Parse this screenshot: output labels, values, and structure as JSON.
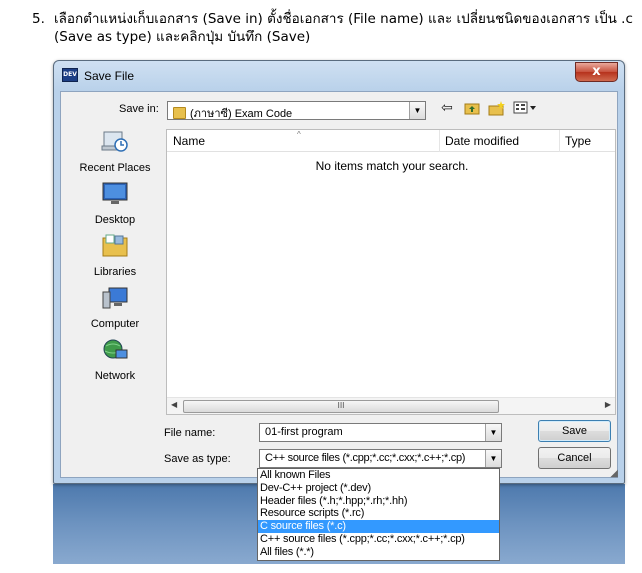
{
  "instruction": {
    "number": "5.",
    "text": "เลือกตำแหน่งเก็บเอกสาร (Save in) ตั้งชื่อเอกสาร (File name) และ เปลี่ยนชนิดของเอกสาร เป็น .c (Save as type) และคลิกปุ่ม บันทึก (Save)"
  },
  "dialog": {
    "title": "Save File",
    "app_icon": "DEV",
    "close_label": "x",
    "save_in_label": "Save in:",
    "save_in_value": "(ภาษาซี) Exam Code",
    "places": [
      {
        "label": "Recent Places",
        "icon": "recent-places-icon"
      },
      {
        "label": "Desktop",
        "icon": "desktop-icon"
      },
      {
        "label": "Libraries",
        "icon": "libraries-icon"
      },
      {
        "label": "Computer",
        "icon": "computer-icon"
      },
      {
        "label": "Network",
        "icon": "network-icon"
      }
    ],
    "columns": [
      "Name",
      "Date modified",
      "Type"
    ],
    "empty_message": "No items match your search.",
    "scroll_grip": "III",
    "file_name_label": "File name:",
    "file_name_value": "01-first program",
    "save_as_type_label": "Save as type:",
    "save_as_type_value": "C++ source files (*.cpp;*.cc;*.cxx;*.c++;*.cp)",
    "save_button": "Save",
    "cancel_button": "Cancel",
    "type_options": [
      "All known Files",
      "Dev-C++ project (*.dev)",
      "Header files (*.h;*.hpp;*.rh;*.hh)",
      "Resource scripts (*.rc)",
      "C source files (*.c)",
      "C++ source files (*.cpp;*.cc;*.cxx;*.c++;*.cp)",
      "All files (*.*)"
    ],
    "selected_type_index": 4
  }
}
